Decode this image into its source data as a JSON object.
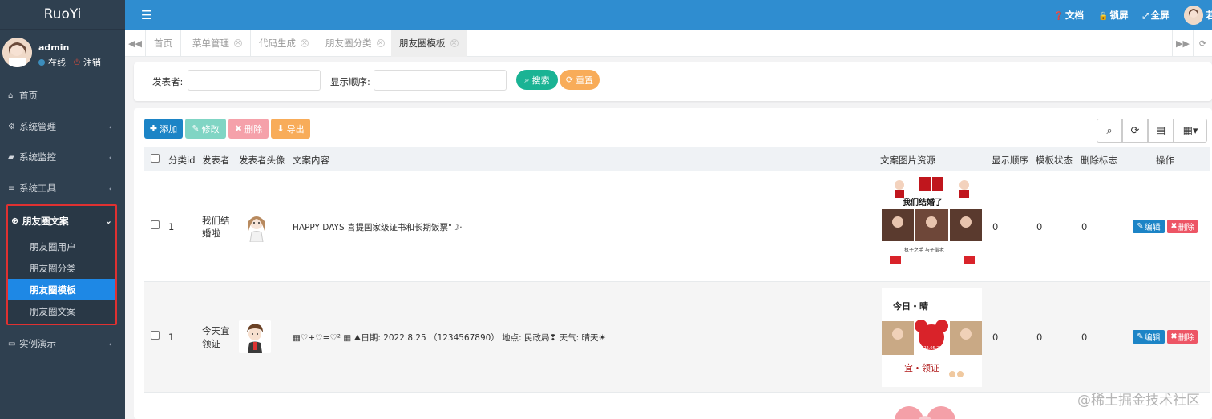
{
  "brand": "RuoYi",
  "user": {
    "name": "admin",
    "status": "在线",
    "logout": "注销"
  },
  "sidebar": {
    "items": [
      {
        "label": "首页",
        "icon": "home-icon"
      },
      {
        "label": "系统管理",
        "icon": "gear-icon"
      },
      {
        "label": "系统监控",
        "icon": "video-icon"
      },
      {
        "label": "系统工具",
        "icon": "bars-icon"
      },
      {
        "label": "实例演示",
        "icon": "desktop-icon"
      }
    ],
    "open_group": {
      "label": "朋友圈文案",
      "children": [
        "朋友圈用户",
        "朋友圈分类",
        "朋友圈模板",
        "朋友圈文案"
      ],
      "active_index": 2
    }
  },
  "topbar": {
    "docs": "文档",
    "lock": "锁屏",
    "fullscreen": "全屏",
    "user_fragment": "若"
  },
  "tabs": [
    "首页",
    "菜单管理",
    "代码生成",
    "朋友圈分类",
    "朋友圈模板"
  ],
  "active_tab": "朋友圈模板",
  "search": {
    "publisher_label": "发表者:",
    "publisher_value": "",
    "order_label": "显示顺序:",
    "order_value": "",
    "search_button": "搜索",
    "reset_button": "重置"
  },
  "toolbar": {
    "add": "添加",
    "edit": "修改",
    "delete": "删除",
    "export": "导出"
  },
  "table": {
    "columns": [
      "分类id",
      "发表者",
      "发表者头像",
      "文案内容",
      "文案图片资源",
      "显示顺序",
      "模板状态",
      "删除标志",
      "操作"
    ],
    "rows": [
      {
        "category_id": "1",
        "publisher": "我们结婚啦",
        "content": "HAPPY DAYS 喜提国家级证书和长期饭票\"☽·",
        "image_top_text": "我们结婚了",
        "image_bottom_text": "执子之手 与子偕老",
        "order": "0",
        "status": "0",
        "del_flag": "0",
        "edit": "编辑",
        "remove": "删除"
      },
      {
        "category_id": "1",
        "publisher": "今天宜领证",
        "content": "▦♡+♡=♡² ▦ ⛰日期: 2022.8.25 （1234567890） 地点: 民政局❢ 天气: 晴天☀",
        "image_top_text": "今日・晴",
        "image_date_text": "2022.05.20",
        "image_bottom_text": "宜・领证",
        "order": "0",
        "status": "0",
        "del_flag": "0",
        "edit": "编辑",
        "remove": "删除"
      }
    ]
  },
  "watermark": "@稀土掘金技术社区",
  "colors": {
    "sidebar_bg": "#2f4050",
    "topbar_bg": "#2f8dd0",
    "primary": "#1c84c6",
    "success": "#1ab394",
    "danger": "#ed5565",
    "warning": "#f8ac59",
    "highlight_border": "#e03131"
  }
}
